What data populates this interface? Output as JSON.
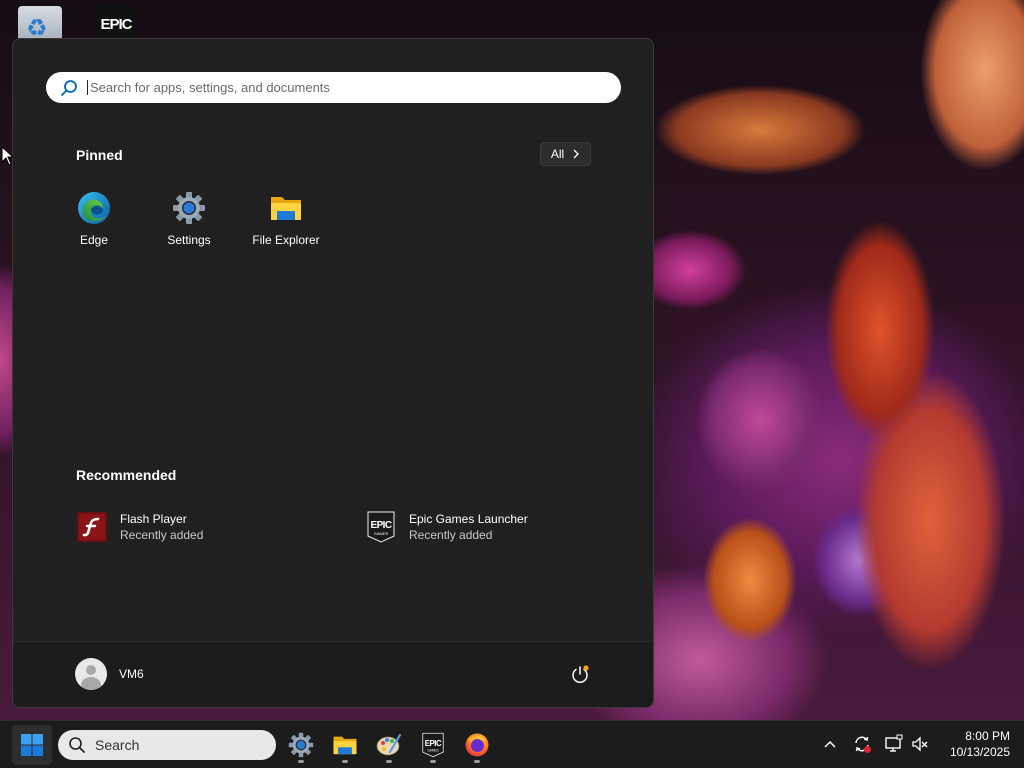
{
  "desktop": {
    "icons": [
      {
        "name": "Recycle Bin",
        "icon": "recycle-bin-icon"
      },
      {
        "name": "Epic Games",
        "icon": "epic-games-icon",
        "logo_text": "EPIC"
      }
    ]
  },
  "start_menu": {
    "search": {
      "placeholder": "Search for apps, settings, and documents",
      "value": ""
    },
    "pinned": {
      "title": "Pinned",
      "all_label": "All",
      "apps": [
        {
          "label": "Edge",
          "icon": "edge-icon"
        },
        {
          "label": "Settings",
          "icon": "settings-gear-icon"
        },
        {
          "label": "File Explorer",
          "icon": "folder-icon"
        }
      ]
    },
    "recommended": {
      "title": "Recommended",
      "items": [
        {
          "name": "Flash Player",
          "subtitle": "Recently added",
          "icon": "flash-player-icon"
        },
        {
          "name": "Epic Games Launcher",
          "subtitle": "Recently added",
          "icon": "epic-games-icon"
        }
      ]
    },
    "footer": {
      "user_name": "VM6",
      "power_icon": "power-icon"
    }
  },
  "taskbar": {
    "search_label": "Search",
    "apps": [
      {
        "name": "Settings",
        "icon": "settings-gear-icon"
      },
      {
        "name": "File Explorer",
        "icon": "folder-icon"
      },
      {
        "name": "Paint",
        "icon": "paint-palette-icon"
      },
      {
        "name": "Epic Games Launcher",
        "icon": "epic-games-icon"
      },
      {
        "name": "Firefox",
        "icon": "firefox-icon"
      }
    ],
    "tray": {
      "icons": [
        "chevron-up-icon",
        "sync-icon",
        "display-icon",
        "speaker-muted-icon"
      ]
    },
    "clock": {
      "time": "8:00 PM",
      "date": "10/13/2025"
    }
  },
  "colors": {
    "menu_background": "#202020",
    "taskbar_background": "#1c1c1c",
    "accent": "#0078d4"
  }
}
